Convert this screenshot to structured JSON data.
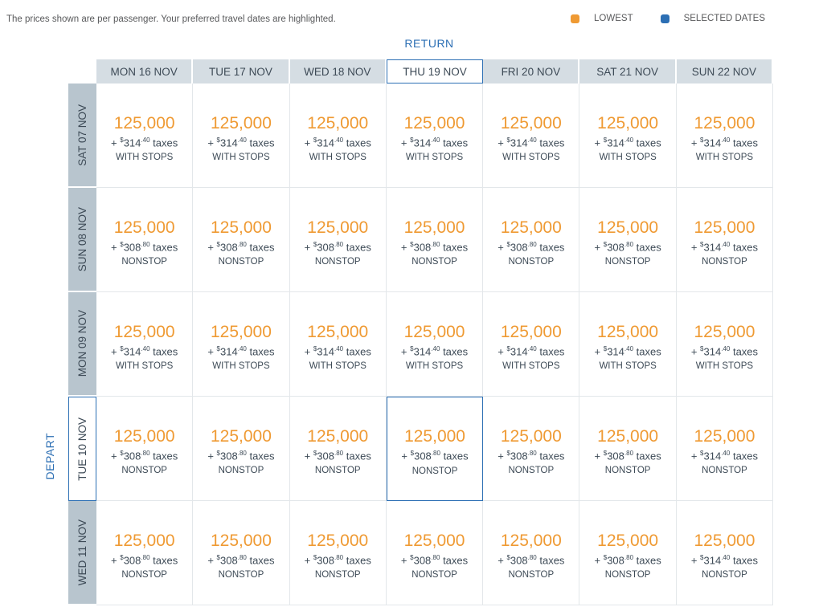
{
  "info_text": "The prices shown are per passenger. Your preferred travel dates are highlighted.",
  "legend": [
    {
      "label": "LOWEST",
      "color": "#ef9a33"
    },
    {
      "label": "SELECTED DATES",
      "color": "#2c6fb4"
    }
  ],
  "return_label": "RETURN",
  "depart_label": "DEPART",
  "return_dates": [
    "MON 16 NOV",
    "TUE 17 NOV",
    "WED 18 NOV",
    "THU 19 NOV",
    "FRI 20 NOV",
    "SAT 21 NOV",
    "SUN 22 NOV"
  ],
  "depart_dates": [
    "SAT 07 NOV",
    "SUN 08 NOV",
    "MON 09 NOV",
    "TUE 10 NOV",
    "WED 11 NOV"
  ],
  "selected": {
    "return_index": 3,
    "depart_index": 3
  },
  "taxes_word": "taxes",
  "rows": [
    {
      "cells": [
        {
          "miles": "125,000",
          "dollars": "314",
          "cents": "40",
          "stops": "WITH STOPS"
        },
        {
          "miles": "125,000",
          "dollars": "314",
          "cents": "40",
          "stops": "WITH STOPS"
        },
        {
          "miles": "125,000",
          "dollars": "314",
          "cents": "40",
          "stops": "WITH STOPS"
        },
        {
          "miles": "125,000",
          "dollars": "314",
          "cents": "40",
          "stops": "WITH STOPS"
        },
        {
          "miles": "125,000",
          "dollars": "314",
          "cents": "40",
          "stops": "WITH STOPS"
        },
        {
          "miles": "125,000",
          "dollars": "314",
          "cents": "40",
          "stops": "WITH STOPS"
        },
        {
          "miles": "125,000",
          "dollars": "314",
          "cents": "40",
          "stops": "WITH STOPS"
        }
      ]
    },
    {
      "cells": [
        {
          "miles": "125,000",
          "dollars": "308",
          "cents": "80",
          "stops": "NONSTOP"
        },
        {
          "miles": "125,000",
          "dollars": "308",
          "cents": "80",
          "stops": "NONSTOP"
        },
        {
          "miles": "125,000",
          "dollars": "308",
          "cents": "80",
          "stops": "NONSTOP"
        },
        {
          "miles": "125,000",
          "dollars": "308",
          "cents": "80",
          "stops": "NONSTOP"
        },
        {
          "miles": "125,000",
          "dollars": "308",
          "cents": "80",
          "stops": "NONSTOP"
        },
        {
          "miles": "125,000",
          "dollars": "308",
          "cents": "80",
          "stops": "NONSTOP"
        },
        {
          "miles": "125,000",
          "dollars": "314",
          "cents": "40",
          "stops": "NONSTOP"
        }
      ]
    },
    {
      "cells": [
        {
          "miles": "125,000",
          "dollars": "314",
          "cents": "40",
          "stops": "WITH STOPS"
        },
        {
          "miles": "125,000",
          "dollars": "314",
          "cents": "40",
          "stops": "WITH STOPS"
        },
        {
          "miles": "125,000",
          "dollars": "314",
          "cents": "40",
          "stops": "WITH STOPS"
        },
        {
          "miles": "125,000",
          "dollars": "314",
          "cents": "40",
          "stops": "WITH STOPS"
        },
        {
          "miles": "125,000",
          "dollars": "314",
          "cents": "40",
          "stops": "WITH STOPS"
        },
        {
          "miles": "125,000",
          "dollars": "314",
          "cents": "40",
          "stops": "WITH STOPS"
        },
        {
          "miles": "125,000",
          "dollars": "314",
          "cents": "40",
          "stops": "WITH STOPS"
        }
      ]
    },
    {
      "cells": [
        {
          "miles": "125,000",
          "dollars": "308",
          "cents": "80",
          "stops": "NONSTOP"
        },
        {
          "miles": "125,000",
          "dollars": "308",
          "cents": "80",
          "stops": "NONSTOP"
        },
        {
          "miles": "125,000",
          "dollars": "308",
          "cents": "80",
          "stops": "NONSTOP"
        },
        {
          "miles": "125,000",
          "dollars": "308",
          "cents": "80",
          "stops": "NONSTOP"
        },
        {
          "miles": "125,000",
          "dollars": "308",
          "cents": "80",
          "stops": "NONSTOP"
        },
        {
          "miles": "125,000",
          "dollars": "308",
          "cents": "80",
          "stops": "NONSTOP"
        },
        {
          "miles": "125,000",
          "dollars": "314",
          "cents": "40",
          "stops": "NONSTOP"
        }
      ]
    },
    {
      "cells": [
        {
          "miles": "125,000",
          "dollars": "308",
          "cents": "80",
          "stops": "NONSTOP"
        },
        {
          "miles": "125,000",
          "dollars": "308",
          "cents": "80",
          "stops": "NONSTOP"
        },
        {
          "miles": "125,000",
          "dollars": "308",
          "cents": "80",
          "stops": "NONSTOP"
        },
        {
          "miles": "125,000",
          "dollars": "308",
          "cents": "80",
          "stops": "NONSTOP"
        },
        {
          "miles": "125,000",
          "dollars": "308",
          "cents": "80",
          "stops": "NONSTOP"
        },
        {
          "miles": "125,000",
          "dollars": "308",
          "cents": "80",
          "stops": "NONSTOP"
        },
        {
          "miles": "125,000",
          "dollars": "314",
          "cents": "40",
          "stops": "NONSTOP"
        }
      ]
    }
  ]
}
